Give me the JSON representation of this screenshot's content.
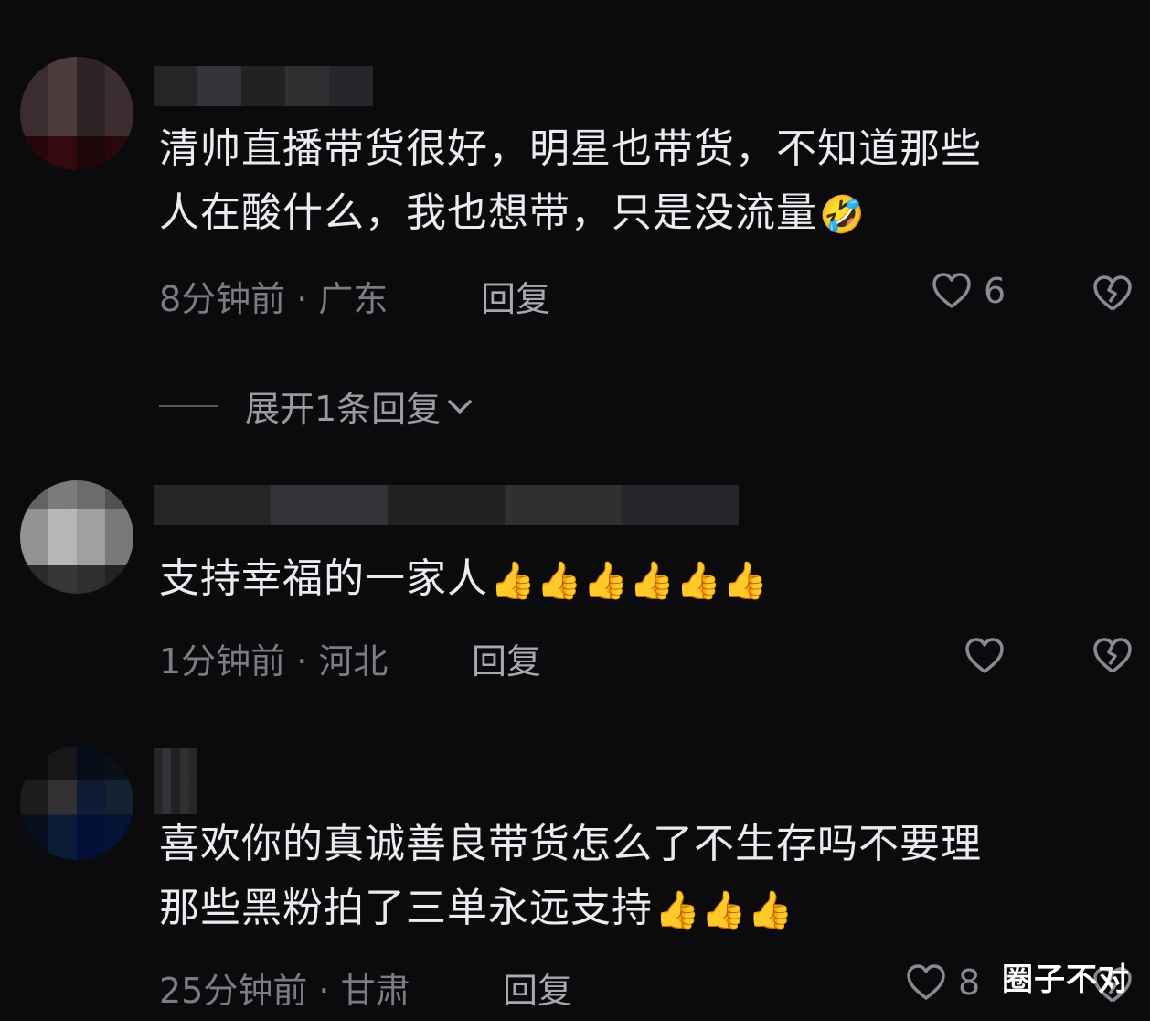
{
  "comments": [
    {
      "text_line1": "清帅直播带货很好，明星也带货，不知道那些",
      "text_line2": "人在酸什么，我也想带，只是没流量",
      "emoji": "🤣",
      "meta": "8分钟前 · 广东",
      "reply_label": "回复",
      "like_count": "6"
    },
    {
      "text_line1": "支持幸福的一家人",
      "emoji": "👍👍👍👍👍👍",
      "meta": "1分钟前 · 河北",
      "reply_label": "回复"
    },
    {
      "text_line1": "喜欢你的真诚善良带货怎么了不生存吗不要理",
      "text_line2": "那些黑粉拍了三单永远支持",
      "emoji": "👍👍👍",
      "meta": "25分钟前 · 甘肃",
      "reply_label": "回复",
      "like_count": "8"
    }
  ],
  "expand_replies": "展开1条回复",
  "watermark": "圈子不对",
  "icons": {
    "like": "heart-outline-icon",
    "dislike": "broken-heart-icon",
    "expand": "chevron-down-icon"
  },
  "colors": {
    "background": "#0b0b0d",
    "text": "#ececf0",
    "meta": "#7c7c82"
  }
}
